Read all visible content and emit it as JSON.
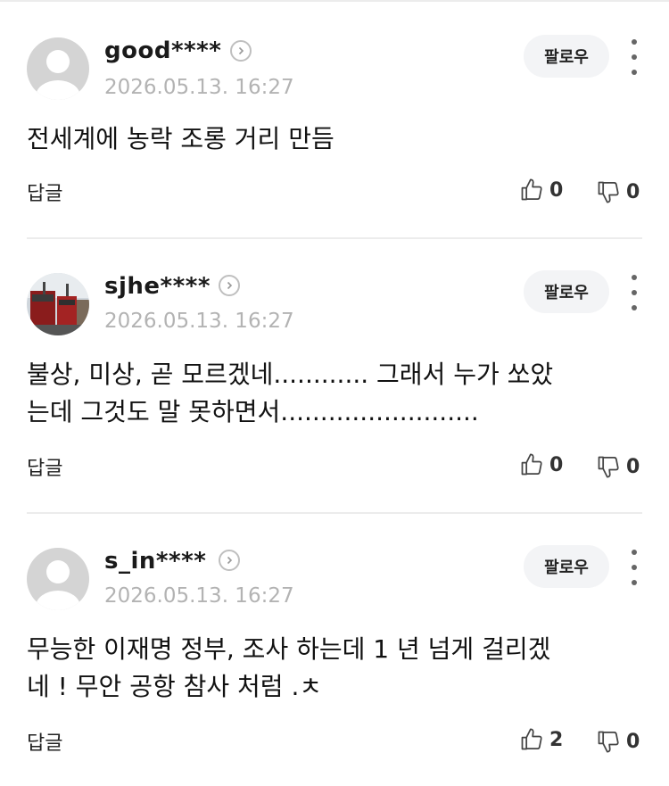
{
  "follow_label": "팔로우",
  "reply_label": "답글",
  "comments": [
    {
      "username": "good****",
      "date": "2026.05.13. 16:27",
      "text": [
        "전세계에 농락 조롱 거리 만듬"
      ],
      "likes": "0",
      "dislikes": "0",
      "avatar": "default"
    },
    {
      "username": "sjhe****",
      "date": "2026.05.13. 16:27",
      "text": [
        "불상, 미상, 곧 모르겠네............ 그래서 누가 쏘았",
        "는데 그것도 말 못하면서........................."
      ],
      "likes": "0",
      "dislikes": "0",
      "avatar": "photo"
    },
    {
      "username": "s_in****",
      "date": "2026.05.13. 16:27",
      "text": [
        "무능한 이재명 정부, 조사 하는데 1 년 넘게 걸리겠",
        "네 ! 무안 공항 참사 처럼 .ㅊ"
      ],
      "likes": "2",
      "dislikes": "0",
      "avatar": "default"
    }
  ]
}
